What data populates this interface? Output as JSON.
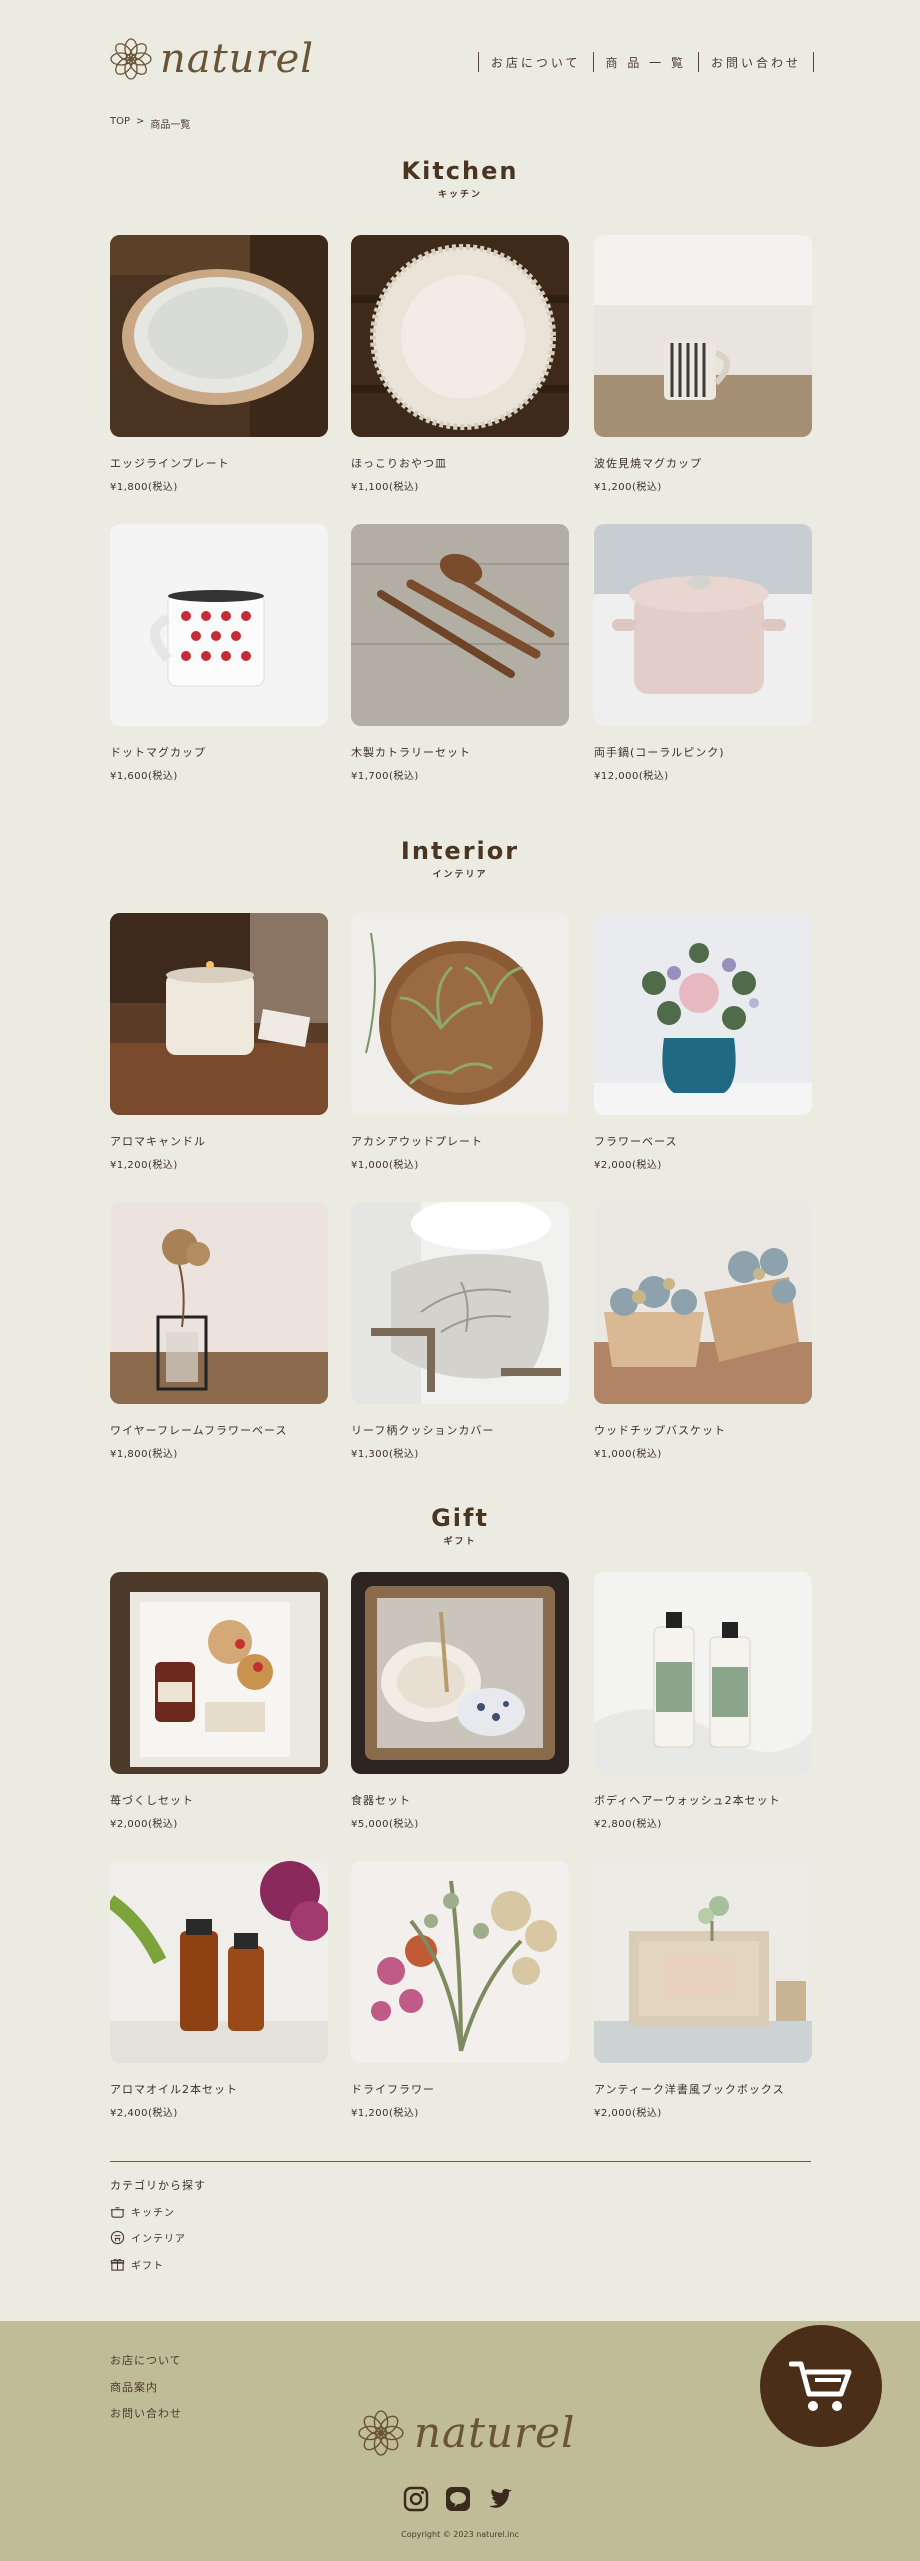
{
  "brand": {
    "logo_text": "naturel"
  },
  "nav": {
    "items": [
      "お店について",
      "商 品 一 覧",
      "お問い合わせ"
    ]
  },
  "breadcrumb": {
    "home": "TOP",
    "separator": ">",
    "current": "商品一覧"
  },
  "sections": [
    {
      "title_en": "Kitchen",
      "title_ja": "キッチン",
      "products": [
        {
          "name": "エッジラインプレート",
          "price": "¥1,800(税込)",
          "image": "rim-plate"
        },
        {
          "name": "ほっこりおやつ皿",
          "price": "¥1,100(税込)",
          "image": "scalloped-plate"
        },
        {
          "name": "波佐見焼マグカップ",
          "price": "¥1,200(税込)",
          "image": "striped-mug"
        },
        {
          "name": "ドットマグカップ",
          "price": "¥1,600(税込)",
          "image": "dot-mug"
        },
        {
          "name": "木製カトラリーセット",
          "price": "¥1,700(税込)",
          "image": "wood-cutlery"
        },
        {
          "name": "両手鍋(コーラルピンク)",
          "price": "¥12,000(税込)",
          "image": "pink-pot"
        }
      ]
    },
    {
      "title_en": "Interior",
      "title_ja": "インテリア",
      "products": [
        {
          "name": "アロマキャンドル",
          "price": "¥1,200(税込)",
          "image": "candle"
        },
        {
          "name": "アカシアウッドプレート",
          "price": "¥1,000(税込)",
          "image": "wood-plate"
        },
        {
          "name": "フラワーベース",
          "price": "¥2,000(税込)",
          "image": "flower-vase"
        },
        {
          "name": "ワイヤーフレームフラワーベース",
          "price": "¥1,800(税込)",
          "image": "wire-vase"
        },
        {
          "name": "リーフ柄クッションカバー",
          "price": "¥1,300(税込)",
          "image": "cushion"
        },
        {
          "name": "ウッドチップバスケット",
          "price": "¥1,000(税込)",
          "image": "basket"
        }
      ]
    },
    {
      "title_en": "Gift",
      "title_ja": "ギフト",
      "products": [
        {
          "name": "苺づくしセット",
          "price": "¥2,000(税込)",
          "image": "strawberry-set"
        },
        {
          "name": "食器セット",
          "price": "¥5,000(税込)",
          "image": "tableware-set"
        },
        {
          "name": "ボディヘアーウォッシュ2本セット",
          "price": "¥2,800(税込)",
          "image": "wash-bottles"
        },
        {
          "name": "アロマオイル2本セット",
          "price": "¥2,400(税込)",
          "image": "aroma-oil"
        },
        {
          "name": "ドライフラワー",
          "price": "¥1,200(税込)",
          "image": "dry-flower"
        },
        {
          "name": "アンティーク洋書風ブックボックス",
          "price": "¥2,000(税込)",
          "image": "book-box"
        }
      ]
    }
  ],
  "categories": {
    "title": "カテゴリから探す",
    "items": [
      {
        "label": "キッチン",
        "icon": "pot-icon"
      },
      {
        "label": "インテリア",
        "icon": "chair-icon"
      },
      {
        "label": "ギフト",
        "icon": "gift-icon"
      }
    ]
  },
  "footer": {
    "links": [
      "お店について",
      "商品案内",
      "お問い合わせ"
    ],
    "logo_text": "naturel",
    "social": [
      "instagram-icon",
      "line-icon",
      "twitter-icon"
    ],
    "copyright": "Copyright © 2023 naturel.inc"
  },
  "cart": {
    "icon": "cart-icon"
  },
  "colors": {
    "background": "#ecebe2",
    "footer": "#c1bc98",
    "text": "#4a3b2c",
    "cart": "#4b2e17"
  }
}
